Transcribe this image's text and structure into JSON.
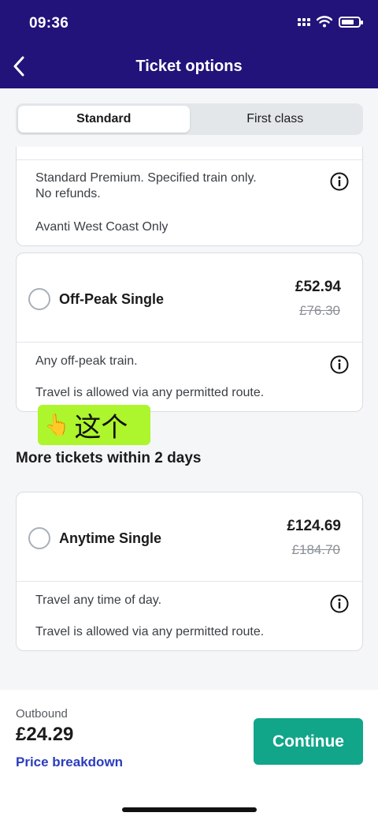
{
  "status": {
    "time": "09:36"
  },
  "header": {
    "title": "Ticket options"
  },
  "tabs": [
    {
      "label": "Standard",
      "active": true
    },
    {
      "label": "First class",
      "active": false
    }
  ],
  "partial_card": {
    "lines": [
      "Standard Premium. Specified train only.",
      "No refunds.",
      "Avanti West Coast Only"
    ]
  },
  "off_peak": {
    "name": "Off-Peak Single",
    "price": "£52.94",
    "old_price": "£76.30",
    "lines": [
      "Any off-peak train.",
      "Travel is allowed via any permitted route."
    ]
  },
  "annotation": {
    "emoji": "👆",
    "text": "这个"
  },
  "more_section": {
    "title": "More tickets within 2 days"
  },
  "anytime": {
    "name": "Anytime Single",
    "price": "£124.69",
    "old_price": "£184.70",
    "lines": [
      "Travel any time of day.",
      "Travel is allowed via any permitted route."
    ]
  },
  "footer": {
    "outbound_label": "Outbound",
    "total": "£24.29",
    "breakdown_label": "Price breakdown",
    "continue_label": "Continue"
  },
  "colors": {
    "header_bg": "#22137a",
    "continue_bg": "#11a58a",
    "link": "#2b3cbc",
    "annotation_bg": "#adf52c"
  },
  "icons": [
    "back-chevron-icon",
    "info-icon",
    "signal-icon",
    "wifi-icon",
    "battery-icon",
    "pointing-hand-icon"
  ]
}
